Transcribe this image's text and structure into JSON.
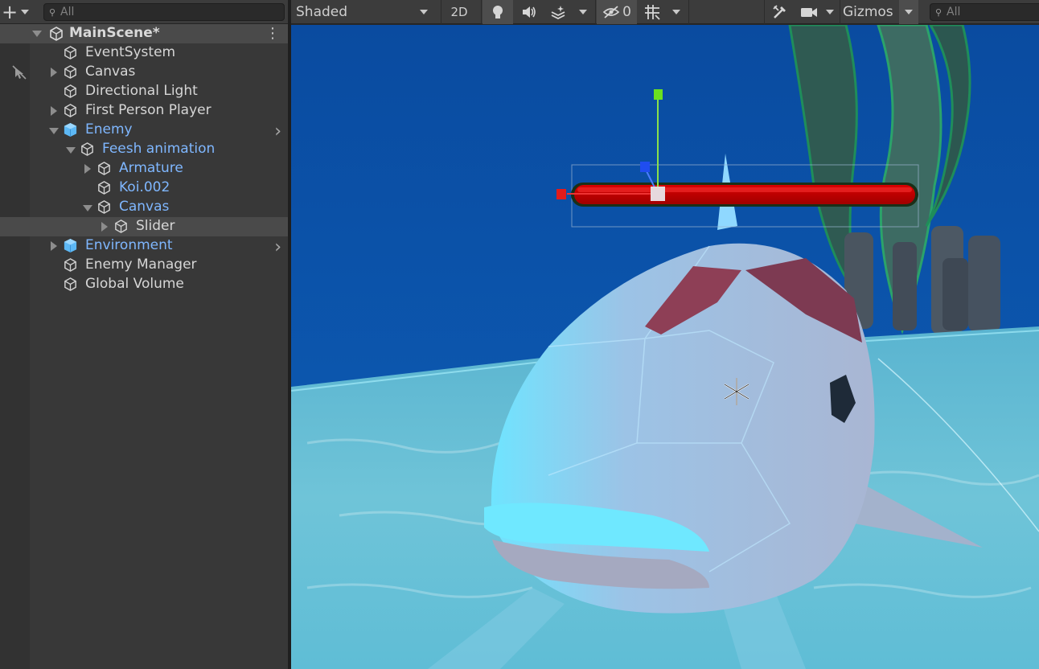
{
  "hierarchy": {
    "search_placeholder": "All",
    "scene_name": "MainScene*",
    "items": [
      {
        "label": "EventSystem",
        "depth": 0,
        "expand": "none",
        "prefab": false
      },
      {
        "label": "Canvas",
        "depth": 0,
        "expand": "collapsed",
        "prefab": false
      },
      {
        "label": "Directional Light",
        "depth": 0,
        "expand": "none",
        "prefab": false
      },
      {
        "label": "First Person Player",
        "depth": 0,
        "expand": "collapsed",
        "prefab": false
      },
      {
        "label": "Enemy",
        "depth": 0,
        "expand": "expanded",
        "prefab": true
      },
      {
        "label": "Feesh animation",
        "depth": 1,
        "expand": "expanded",
        "prefab": true
      },
      {
        "label": "Armature",
        "depth": 2,
        "expand": "collapsed",
        "prefab": true
      },
      {
        "label": "Koi.002",
        "depth": 2,
        "expand": "none",
        "prefab": true
      },
      {
        "label": "Canvas",
        "depth": 2,
        "expand": "expanded",
        "prefab": true
      },
      {
        "label": "Slider",
        "depth": 3,
        "expand": "collapsed",
        "prefab": false,
        "selected": true
      },
      {
        "label": "Environment",
        "depth": 0,
        "expand": "collapsed",
        "prefab": true
      },
      {
        "label": "Enemy Manager",
        "depth": 0,
        "expand": "none",
        "prefab": false
      },
      {
        "label": "Global Volume",
        "depth": 0,
        "expand": "none",
        "prefab": false
      }
    ]
  },
  "scene_toolbar": {
    "shading_mode": "Shaded",
    "mode_2d": "2D",
    "hidden_count": "0",
    "gizmos_label": "Gizmos",
    "search_placeholder": "All"
  },
  "colors": {
    "prefab_text": "#7fb7ff",
    "selection_row": "#4a4a4a",
    "panel_bg": "#383838",
    "health_bar": "#c00000",
    "water": "#0a4fa3",
    "sand": "#6cc4d4"
  }
}
